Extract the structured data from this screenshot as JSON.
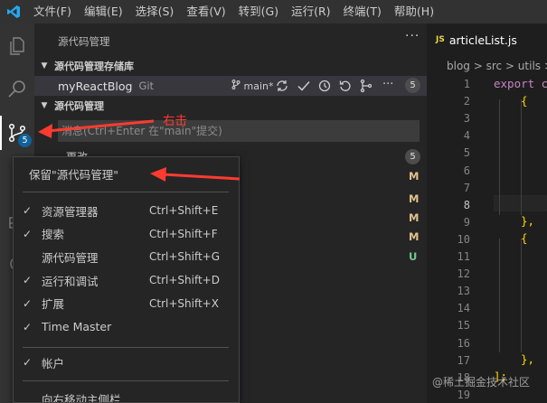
{
  "menubar": {
    "items": [
      "文件(F)",
      "编辑(E)",
      "选择(S)",
      "查看(V)",
      "转到(G)",
      "运行(R)",
      "终端(T)",
      "帮助(H)"
    ]
  },
  "activity": {
    "scm_badge": "5"
  },
  "sidebar": {
    "title": "源代码管理",
    "more": "···",
    "repos_header": "源代码管理存储库",
    "repo": {
      "name": "myReactBlog",
      "provider": "Git",
      "branch": "main*",
      "count": "5"
    },
    "scm_header": "源代码管理",
    "message_placeholder": "消息(Ctrl+Enter 在\"main\"提交)",
    "changes_label": "更改",
    "changes_count": "5",
    "file_statuses": [
      "M",
      "M",
      "M",
      "M",
      "U"
    ]
  },
  "editor": {
    "tab_lang": "JS",
    "tab_name": "articleList.js",
    "breadcrumb": "blog > src > utils >",
    "line_numbers": [
      "1",
      "2",
      "3",
      "4",
      "5",
      "6",
      "7",
      "8",
      "9",
      "10",
      "11",
      "12",
      "13",
      "14",
      "15",
      "16",
      "17",
      "18",
      "19"
    ],
    "current_line": "8",
    "code": {
      "l1": "export c",
      "l2": "{",
      "l9": "},",
      "l10": "{",
      "l17": "},",
      "l18": "];"
    }
  },
  "context_menu": {
    "keep_item": "保留\"源代码管理\"",
    "items": [
      {
        "checked": "✓",
        "label": "资源管理器",
        "shortcut": "Ctrl+Shift+E"
      },
      {
        "checked": "✓",
        "label": "搜索",
        "shortcut": "Ctrl+Shift+F"
      },
      {
        "checked": "",
        "label": "源代码管理",
        "shortcut": "Ctrl+Shift+G"
      },
      {
        "checked": "✓",
        "label": "运行和调试",
        "shortcut": "Ctrl+Shift+D"
      },
      {
        "checked": "✓",
        "label": "扩展",
        "shortcut": "Ctrl+Shift+X"
      },
      {
        "checked": "✓",
        "label": "Time Master",
        "shortcut": ""
      }
    ],
    "accounts": {
      "checked": "✓",
      "label": "帐户"
    },
    "move_sidebar": "向右移动主侧栏"
  },
  "annotation": {
    "right_click": "右击"
  },
  "watermark": "@稀土掘金技术社区",
  "colors": {
    "accent": "#0e639c",
    "annotation_red": "#ff3b30",
    "modified": "#e2c08d",
    "untracked": "#73c991"
  }
}
